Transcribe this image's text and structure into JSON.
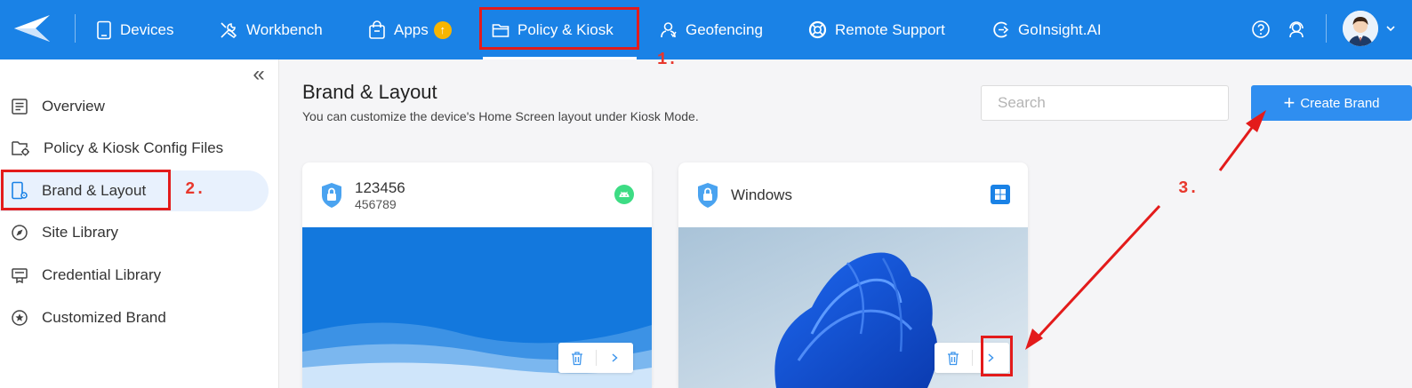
{
  "nav": {
    "items": [
      {
        "label": "Devices",
        "icon": "device-icon"
      },
      {
        "label": "Workbench",
        "icon": "tools-icon"
      },
      {
        "label": "Apps",
        "icon": "bag-icon",
        "badge": "↑"
      },
      {
        "label": "Policy & Kiosk",
        "icon": "folder-icon",
        "active": true
      },
      {
        "label": "Geofencing",
        "icon": "location-person-icon"
      },
      {
        "label": "Remote Support",
        "icon": "lifebuoy-icon"
      },
      {
        "label": "GoInsight.AI",
        "icon": "ai-icon"
      }
    ],
    "right_icons": [
      "help-icon",
      "support-agent-icon"
    ],
    "accent": "#1a82e6"
  },
  "sidebar": {
    "collapse_glyph": "«",
    "items": [
      {
        "label": "Overview",
        "icon": "document-list-icon"
      },
      {
        "label": "Policy & Kiosk Config Files",
        "icon": "folder-settings-icon"
      },
      {
        "label": "Brand & Layout",
        "icon": "phone-settings-icon",
        "active": true
      },
      {
        "label": "Site Library",
        "icon": "compass-icon"
      },
      {
        "label": "Credential Library",
        "icon": "certificate-icon"
      },
      {
        "label": "Customized Brand",
        "icon": "star-circle-icon"
      }
    ]
  },
  "main": {
    "title": "Brand & Layout",
    "subtitle": "You can customize the device's Home Screen layout under Kiosk Mode.",
    "search_placeholder": "Search",
    "create_label": "Create Brand",
    "create_plus": "+"
  },
  "cards": [
    {
      "name": "123456",
      "subname": "456789",
      "os": "android-icon",
      "os_color": "#3ddc84"
    },
    {
      "name": "Windows",
      "subname": "",
      "os": "windows-icon",
      "os_color": "#1a82e6"
    }
  ],
  "annotations": {
    "step1": "1.",
    "step2": "2.",
    "step3": "3.",
    "color": "#e31b1b"
  }
}
